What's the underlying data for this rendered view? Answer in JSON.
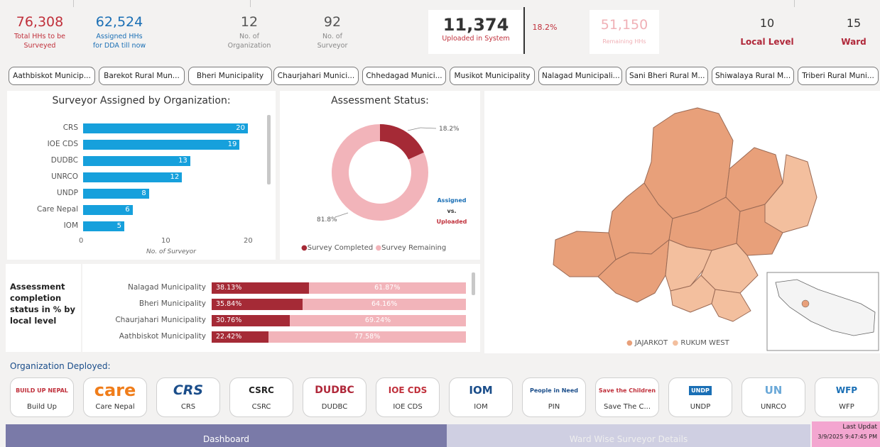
{
  "kpis": {
    "total_hhs": {
      "value": "76,308",
      "label1": "Total HHs to be",
      "label2": "Surveyed"
    },
    "assigned_hhs": {
      "value": "62,524",
      "label1": "Assigned HHs",
      "label2": "for DDA till now"
    },
    "organizations": {
      "value": "12",
      "label1": "No. of",
      "label2": "Organization"
    },
    "surveyors": {
      "value": "92",
      "label1": "No. of",
      "label2": "Surveyor"
    },
    "uploaded": {
      "value": "11,374",
      "label": "Uploaded in System"
    },
    "uploaded_pct": "18.2%",
    "remaining": {
      "value": "51,150",
      "label": "Remaining HHs"
    },
    "local_level": {
      "value": "10",
      "label": "Local Level"
    },
    "ward": {
      "value": "15",
      "label": "Ward"
    }
  },
  "municipalities": [
    "Aathbiskot Municip...",
    "Barekot Rural Mun...",
    "Bheri Municipality",
    "Chaurjahari Munici...",
    "Chhedagad Munici...",
    "Musikot Municipality",
    "Nalagad Municipali...",
    "Sani Bheri Rural M...",
    "Shiwalaya Rural M...",
    "Triberi Rural Muni..."
  ],
  "surveyor_chart": {
    "title": "Surveyor Assigned by Organization:",
    "xlabel": "No. of Surveyor",
    "chart_data": {
      "type": "bar",
      "orientation": "horizontal",
      "categories": [
        "CRS",
        "IOE CDS",
        "DUDBC",
        "UNRCO",
        "UNDP",
        "Care Nepal",
        "IOM"
      ],
      "values": [
        20,
        19,
        13,
        12,
        8,
        6,
        5
      ],
      "xlim": [
        0,
        20
      ],
      "xticks": [
        "0",
        "10",
        "20"
      ],
      "color": "#16a0dc"
    }
  },
  "assessment_status": {
    "title": "Assessment Status:",
    "completed_label": "18.2%",
    "remaining_label": "81.8%",
    "side_label1": "Assigned",
    "side_label2": "vs.",
    "side_label3": "Uploaded",
    "legend": [
      "Survey Completed",
      "Survey Remaining"
    ],
    "colors": [
      "#a52a36",
      "#f2b4ba"
    ],
    "chart_data": {
      "type": "pie",
      "labels": [
        "Survey Completed",
        "Survey Remaining"
      ],
      "values": [
        18.2,
        81.8
      ]
    }
  },
  "completion": {
    "title": "Assessment completion status in % by local level",
    "chart_data": {
      "type": "bar",
      "stacked": true,
      "orientation": "horizontal",
      "categories": [
        "Nalagad Municipality",
        "Bheri Municipality",
        "Chaurjahari Municipality",
        "Aathbiskot Municipality"
      ],
      "series": [
        {
          "values": [
            38.13,
            35.84,
            30.76,
            22.42
          ],
          "labels": [
            "38.13%",
            "35.84%",
            "30.76%",
            "22.42%"
          ]
        },
        {
          "values": [
            61.87,
            64.16,
            69.24,
            77.58
          ],
          "labels": [
            "61.87%",
            "64.16%",
            "69.24%",
            "77.58%"
          ]
        }
      ]
    }
  },
  "map": {
    "legend": [
      "JAJARKOT",
      "RUKUM WEST"
    ],
    "colors": {
      "jajarkot": "#e8a07a",
      "rukum_west": "#f3bf9e"
    }
  },
  "orgs": {
    "title": "Organization Deployed:",
    "items": [
      {
        "name": "Build Up",
        "logo": "BUILD UP NEPAL"
      },
      {
        "name": "Care Nepal",
        "logo": "care"
      },
      {
        "name": "CRS",
        "logo": "CRS"
      },
      {
        "name": "CSRC",
        "logo": "CSRC"
      },
      {
        "name": "DUDBC",
        "logo": "DUDBC"
      },
      {
        "name": "IOE CDS",
        "logo": "IOE CDS"
      },
      {
        "name": "IOM",
        "logo": "IOM"
      },
      {
        "name": "PIN",
        "logo": "People in Need"
      },
      {
        "name": "Save The C...",
        "logo": "Save the Children"
      },
      {
        "name": "UNDP",
        "logo": "UNDP"
      },
      {
        "name": "UNRCO",
        "logo": "UN"
      },
      {
        "name": "WFP",
        "logo": "WFP"
      }
    ]
  },
  "tabs": {
    "dashboard": "Dashboard",
    "ward_wise": "Ward Wise Surveyor Details"
  },
  "update": {
    "label": "Last Updat",
    "time": "3/9/2025 9:47:45 PM"
  }
}
